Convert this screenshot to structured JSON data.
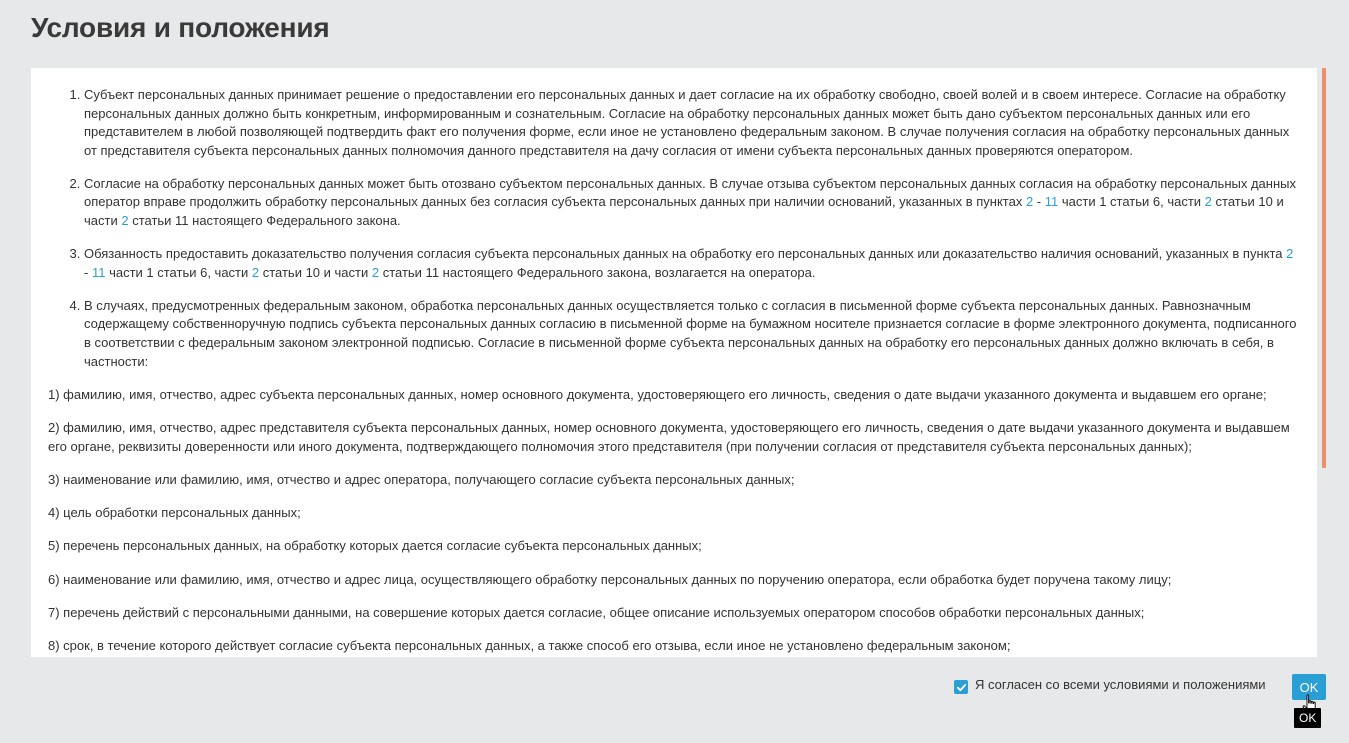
{
  "title": "Условия и положения",
  "articles": [
    [
      {
        "t": "Субъект персональных данных принимает решение о предоставлении его персональных данных и дает согласие на их обработку свободно, своей волей и в своем интересе. Согласие на обработку персональных данных должно быть конкретным, информированным и сознательным. Согласие на обработку персональных данных может быть дано субъектом персональных данных или его представителем в любой позволяющей подтвердить факт его получения форме, если иное не установлено федеральным законом. В случае получения согласия на обработку персональных данных от представителя субъекта персональных данных полномочия данного представителя на дачу согласия от имени субъекта персональных данных проверяются оператором."
      }
    ],
    [
      {
        "t": "Согласие на обработку персональных данных может быть отозвано субъектом персональных данных. В случае отзыва субъектом персональных данных согласия на обработку персональных данных оператор вправе продолжить обработку персональных данных без согласия субъекта персональных данных при наличии оснований, указанных в пунктах "
      },
      {
        "t": "2",
        "link": true
      },
      {
        "t": " - "
      },
      {
        "t": "11",
        "link": true
      },
      {
        "t": " части 1 статьи 6, части "
      },
      {
        "t": "2",
        "link": true
      },
      {
        "t": " статьи 10 и части "
      },
      {
        "t": "2",
        "link": true
      },
      {
        "t": " статьи 11 настоящего Федерального закона."
      }
    ],
    [
      {
        "t": "Обязанность предоставить доказательство получения согласия субъекта персональных данных на обработку его персональных данных или доказательство наличия оснований, указанных в пункта "
      },
      {
        "t": "2",
        "link": true
      },
      {
        "t": " - "
      },
      {
        "t": "11",
        "link": true
      },
      {
        "t": " части 1 статьи 6, части "
      },
      {
        "t": "2",
        "link": true
      },
      {
        "t": " статьи 10 и части "
      },
      {
        "t": "2",
        "link": true
      },
      {
        "t": " статьи 11 настоящего Федерального закона, возлагается на оператора."
      }
    ],
    [
      {
        "t": "В случаях, предусмотренных федеральным законом, обработка персональных данных осуществляется только с согласия в письменной форме субъекта персональных данных. Равнозначным содержащему собственноручную подпись субъекта персональных данных согласию в письменной форме на бумажном носителе признается согласие в форме электронного документа, подписанного в соответствии с федеральным законом электронной подписью. Согласие в письменной форме субъекта персональных данных на обработку его персональных данных должно включать в себя, в частности:"
      }
    ]
  ],
  "items": [
    "1) фамилию, имя, отчество, адрес субъекта персональных данных, номер основного документа, удостоверяющего его личность, сведения о дате выдачи указанного документа и выдавшем его органе;",
    "2) фамилию, имя, отчество, адрес представителя субъекта персональных данных, номер основного документа, удостоверяющего его личность, сведения о дате выдачи указанного документа и выдавшем его органе, реквизиты доверенности или иного документа, подтверждающего полномочия этого представителя (при получении согласия от представителя субъекта персональных данных);",
    "3) наименование или фамилию, имя, отчество и адрес оператора, получающего согласие субъекта персональных данных;",
    "4) цель обработки персональных данных;",
    "5) перечень персональных данных, на обработку которых дается согласие субъекта персональных данных;",
    "6) наименование или фамилию, имя, отчество и адрес лица, осуществляющего обработку персональных данных по поручению оператора, если обработка будет поручена такому лицу;",
    "7) перечень действий с персональными данными, на совершение которых дается согласие, общее описание используемых оператором способов обработки персональных данных;",
    "8) срок, в течение которого действует согласие субъекта персональных данных, а также способ его отзыва, если иное не установлено федеральным законом;"
  ],
  "footer": {
    "agree_checked": true,
    "agree_label": "Я согласен со всеми условиями и положениями",
    "ok_label": "OK",
    "tooltip": "OK"
  },
  "colors": {
    "accent": "#2a9fd6",
    "scroll_thumb": "#ea8f69",
    "background": "#e7e8e9"
  }
}
